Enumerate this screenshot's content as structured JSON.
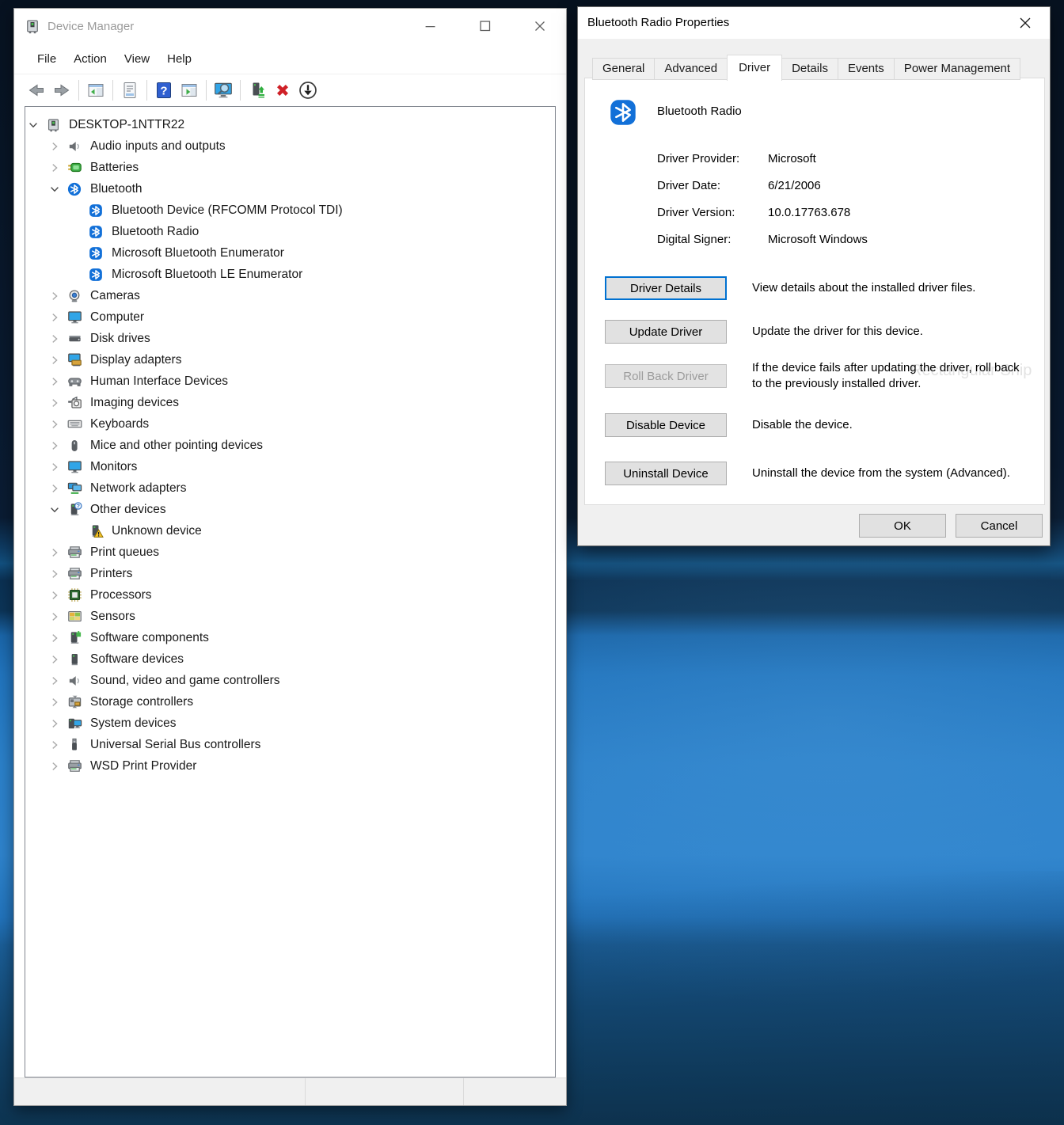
{
  "device_manager": {
    "title": "Device Manager",
    "title_icon": "device-manager-icon",
    "window_controls": [
      "minimize",
      "maximize",
      "close"
    ],
    "menu": [
      "File",
      "Action",
      "View",
      "Help"
    ],
    "toolbar_groups": [
      [
        "back",
        "forward"
      ],
      [
        "show-console-tree"
      ],
      [
        "properties"
      ],
      [
        "help",
        "show-action-pane"
      ],
      [
        "scan-for-hardware-changes"
      ],
      [
        "update-driver",
        "uninstall-device",
        "disable-device"
      ]
    ],
    "tree": [
      {
        "label": "DESKTOP-1NTTR22",
        "icon": "computer-node-icon",
        "level": 0,
        "chevron": "expanded"
      },
      {
        "label": "Audio inputs and outputs",
        "icon": "speaker-icon",
        "level": 1,
        "chevron": "collapsed"
      },
      {
        "label": "Batteries",
        "icon": "battery-icon",
        "level": 1,
        "chevron": "collapsed"
      },
      {
        "label": "Bluetooth",
        "icon": "bluetooth-circle-icon",
        "level": 1,
        "chevron": "expanded"
      },
      {
        "label": "Bluetooth Device (RFCOMM Protocol TDI)",
        "icon": "bluetooth-device-icon",
        "level": 2,
        "chevron": "none"
      },
      {
        "label": "Bluetooth Radio",
        "icon": "bluetooth-device-icon",
        "level": 2,
        "chevron": "none"
      },
      {
        "label": "Microsoft Bluetooth Enumerator",
        "icon": "bluetooth-device-icon",
        "level": 2,
        "chevron": "none"
      },
      {
        "label": "Microsoft Bluetooth LE Enumerator",
        "icon": "bluetooth-device-icon",
        "level": 2,
        "chevron": "none"
      },
      {
        "label": "Cameras",
        "icon": "camera-icon",
        "level": 1,
        "chevron": "collapsed"
      },
      {
        "label": "Computer",
        "icon": "monitor-icon",
        "level": 1,
        "chevron": "collapsed"
      },
      {
        "label": "Disk drives",
        "icon": "disk-drive-icon",
        "level": 1,
        "chevron": "collapsed"
      },
      {
        "label": "Display adapters",
        "icon": "display-adapter-icon",
        "level": 1,
        "chevron": "collapsed"
      },
      {
        "label": "Human Interface Devices",
        "icon": "gamepad-icon",
        "level": 1,
        "chevron": "collapsed"
      },
      {
        "label": "Imaging devices",
        "icon": "imaging-device-icon",
        "level": 1,
        "chevron": "collapsed"
      },
      {
        "label": "Keyboards",
        "icon": "keyboard-icon",
        "level": 1,
        "chevron": "collapsed"
      },
      {
        "label": "Mice and other pointing devices",
        "icon": "mouse-icon",
        "level": 1,
        "chevron": "collapsed"
      },
      {
        "label": "Monitors",
        "icon": "monitor-icon",
        "level": 1,
        "chevron": "collapsed"
      },
      {
        "label": "Network adapters",
        "icon": "network-adapter-icon",
        "level": 1,
        "chevron": "collapsed"
      },
      {
        "label": "Other devices",
        "icon": "other-device-icon",
        "level": 1,
        "chevron": "expanded"
      },
      {
        "label": "Unknown device",
        "icon": "unknown-device-warning-icon",
        "level": 2,
        "chevron": "none"
      },
      {
        "label": "Print queues",
        "icon": "printer-icon",
        "level": 1,
        "chevron": "collapsed"
      },
      {
        "label": "Printers",
        "icon": "printer-icon",
        "level": 1,
        "chevron": "collapsed"
      },
      {
        "label": "Processors",
        "icon": "processor-icon",
        "level": 1,
        "chevron": "collapsed"
      },
      {
        "label": "Sensors",
        "icon": "sensor-icon",
        "level": 1,
        "chevron": "collapsed"
      },
      {
        "label": "Software components",
        "icon": "software-component-icon",
        "level": 1,
        "chevron": "collapsed"
      },
      {
        "label": "Software devices",
        "icon": "software-device-icon",
        "level": 1,
        "chevron": "collapsed"
      },
      {
        "label": "Sound, video and game controllers",
        "icon": "speaker-icon",
        "level": 1,
        "chevron": "collapsed"
      },
      {
        "label": "Storage controllers",
        "icon": "storage-controller-icon",
        "level": 1,
        "chevron": "collapsed"
      },
      {
        "label": "System devices",
        "icon": "system-device-icon",
        "level": 1,
        "chevron": "collapsed"
      },
      {
        "label": "Universal Serial Bus controllers",
        "icon": "usb-icon",
        "level": 1,
        "chevron": "collapsed"
      },
      {
        "label": "WSD Print Provider",
        "icon": "printer-icon",
        "level": 1,
        "chevron": "collapsed"
      }
    ],
    "status_bar_panes": [
      "",
      "",
      ""
    ]
  },
  "dialog": {
    "title": "Bluetooth Radio Properties",
    "close_icon": "close-icon",
    "tabs": [
      {
        "label": "General",
        "active": false
      },
      {
        "label": "Advanced",
        "active": false
      },
      {
        "label": "Driver",
        "active": true
      },
      {
        "label": "Details",
        "active": false
      },
      {
        "label": "Events",
        "active": false
      },
      {
        "label": "Power Management",
        "active": false
      }
    ],
    "device_icon": "bluetooth-icon",
    "device_name": "Bluetooth Radio",
    "fields": [
      {
        "label": "Driver Provider:",
        "value": "Microsoft"
      },
      {
        "label": "Driver Date:",
        "value": "6/21/2006"
      },
      {
        "label": "Driver Version:",
        "value": "10.0.17763.678"
      },
      {
        "label": "Digital Signer:",
        "value": "Microsoft Windows"
      }
    ],
    "actions": [
      {
        "button": "Driver Details",
        "state": "focused",
        "desc": "View details about the installed driver files."
      },
      {
        "button": "Update Driver",
        "state": "normal",
        "desc": "Update the driver for this device."
      },
      {
        "button": "Roll Back Driver",
        "state": "disabled",
        "desc": "If the device fails after updating the driver, roll back to the previously installed driver."
      },
      {
        "button": "Disable Device",
        "state": "normal",
        "desc": "Disable the device."
      },
      {
        "button": "Uninstall Device",
        "state": "normal",
        "desc": "Uninstall the device from the system (Advanced)."
      }
    ],
    "ok_label": "OK",
    "cancel_label": "Cancel",
    "watermark": "Rectangular Snip",
    "accent_color": "#0071d1"
  }
}
